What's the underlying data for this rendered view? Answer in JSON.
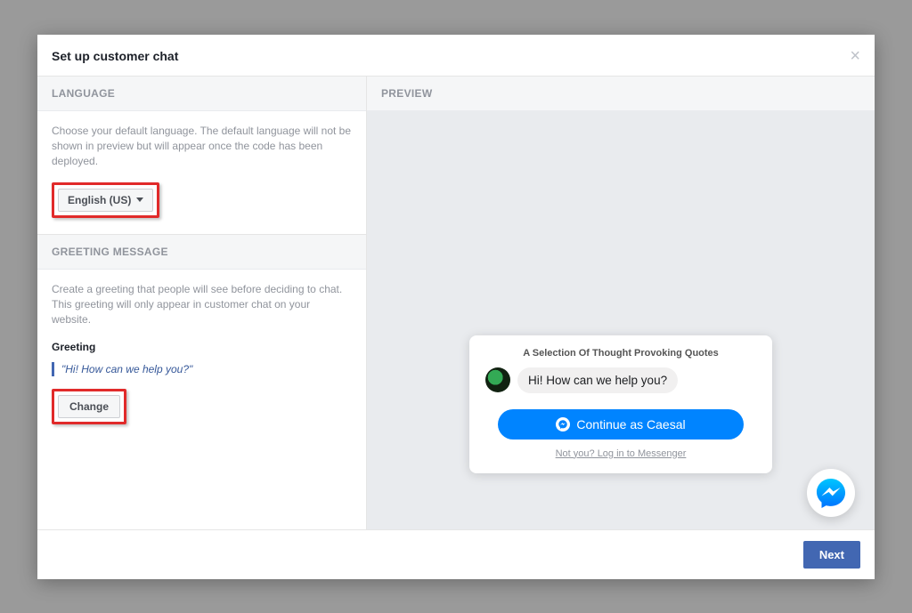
{
  "modal": {
    "title": "Set up customer chat",
    "close_label": "×"
  },
  "language_section": {
    "header": "Language",
    "help": "Choose your default language. The default language will not be shown in preview but will appear once the code has been deployed.",
    "selected": "English (US)"
  },
  "greeting_section": {
    "header": "Greeting Message",
    "help": "Create a greeting that people will see before deciding to chat. This greeting will only appear in customer chat on your website.",
    "label": "Greeting",
    "text": "\"Hi! How can we help you?\"",
    "change_label": "Change"
  },
  "preview": {
    "header": "Preview",
    "card_title": "A Selection Of Thought Provoking Quotes",
    "greeting_bubble": "Hi! How can we help you?",
    "continue_label": "Continue as Caesal",
    "not_you": "Not you? Log in to Messenger"
  },
  "footer": {
    "next": "Next"
  }
}
